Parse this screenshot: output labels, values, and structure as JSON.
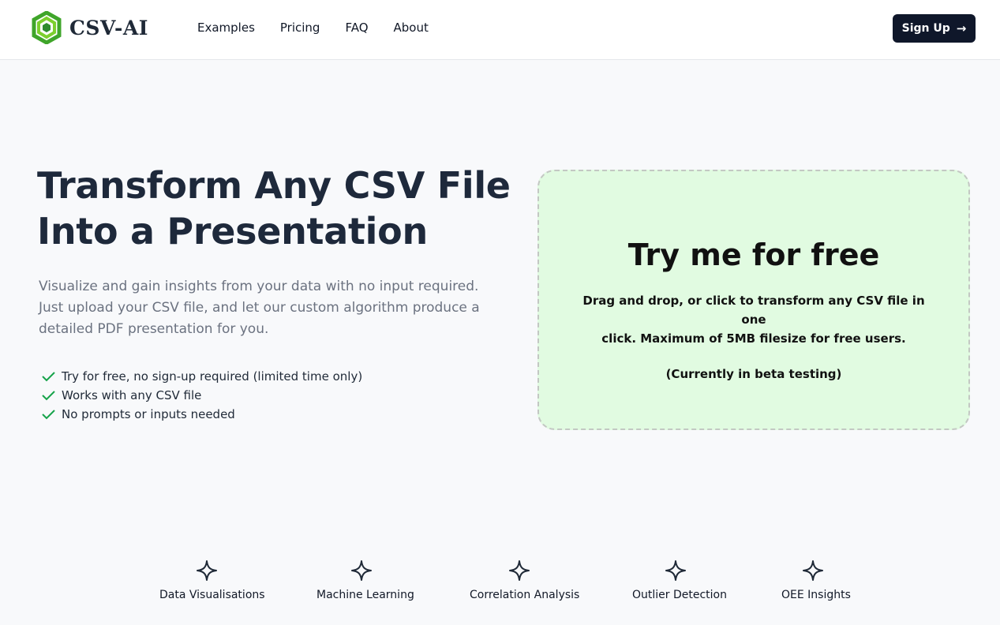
{
  "brand": {
    "name": "CSV-AI",
    "logo_icon": "hexagon-logo-icon",
    "logo_colors": [
      "#4cb82a",
      "#2e8b2e",
      "#7ccf2e"
    ]
  },
  "nav": {
    "items": [
      "Examples",
      "Pricing",
      "FAQ",
      "About"
    ]
  },
  "signup": {
    "label": "Sign Up",
    "icon": "arrow-right-icon"
  },
  "hero": {
    "title_line1": "Transform Any CSV File",
    "title_line2": "Into a Presentation",
    "subtitle_line1": "Visualize and gain insights from your data with no input required.",
    "subtitle_line2": "Just upload your CSV file, and let our custom algorithm produce a",
    "subtitle_line3": "detailed PDF presentation for you.",
    "checks": [
      "Try for free, no sign-up required (limited time only)",
      "Works with any CSV file",
      "No prompts or inputs needed"
    ],
    "check_color": "#16a34a"
  },
  "dropzone": {
    "title": "Try me for free",
    "desc_line1": "Drag and drop, or click to transform any CSV file in one",
    "desc_line2": "click. Maximum of 5MB filesize for free users.",
    "beta": "(Currently in beta testing)",
    "background": "#e1fbe1"
  },
  "features": [
    {
      "label": "Data Visualisations",
      "icon": "sparkle-icon"
    },
    {
      "label": "Machine Learning",
      "icon": "sparkle-icon"
    },
    {
      "label": "Correlation Analysis",
      "icon": "sparkle-icon"
    },
    {
      "label": "Outlier Detection",
      "icon": "sparkle-icon"
    },
    {
      "label": "OEE Insights",
      "icon": "sparkle-icon"
    }
  ]
}
